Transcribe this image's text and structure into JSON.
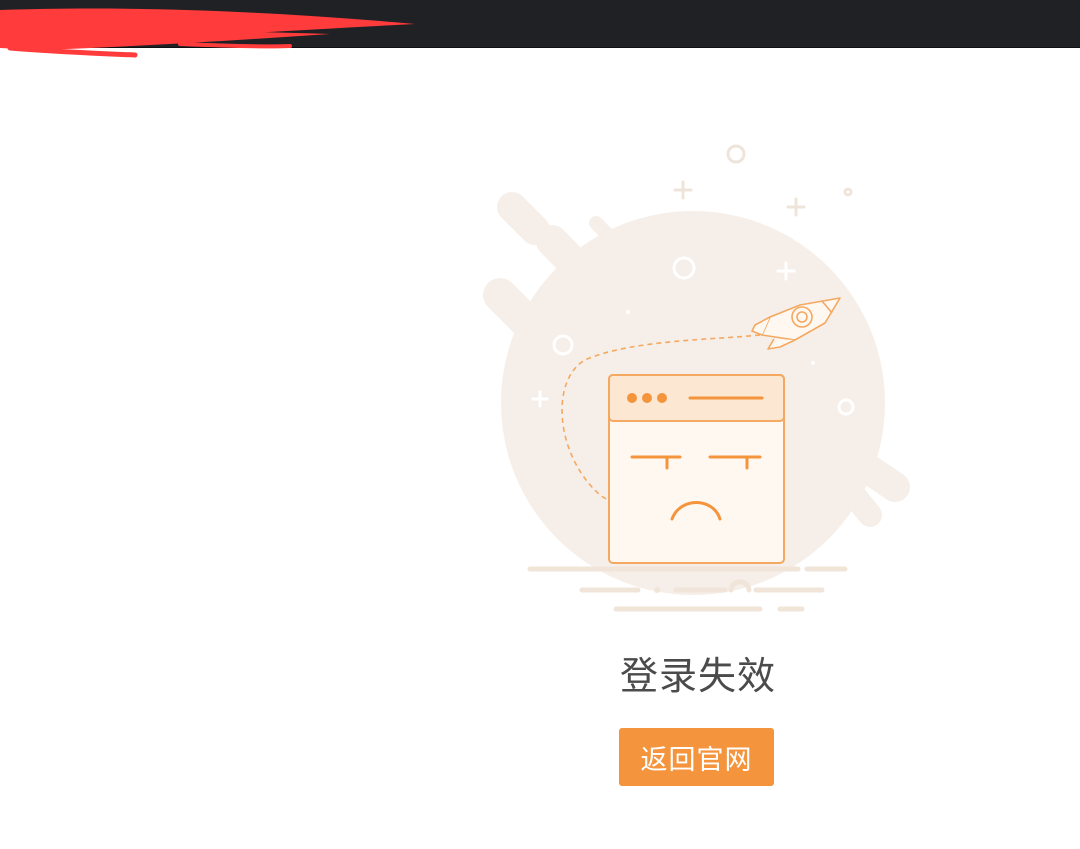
{
  "page": {
    "status_title": "登录失效",
    "back_button_label": "返回官网"
  },
  "icons": {
    "illustration": "sad-browser-window-with-rocket",
    "redaction": "red-scribble"
  },
  "colors": {
    "topbar": "#1f2125",
    "accent": "#f4943d",
    "title_text": "#4b4b4b",
    "illustration_bg": "#f6efe9"
  }
}
